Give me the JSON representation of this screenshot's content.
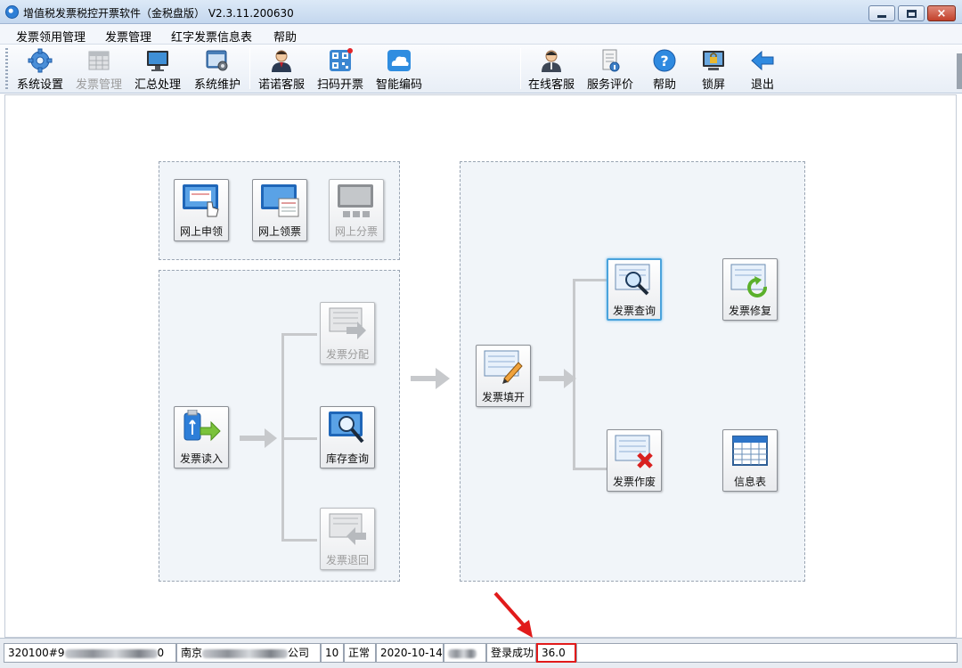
{
  "window": {
    "title": "增值税发票税控开票软件（金税盘版） V2.3.11.200630",
    "controls": {
      "minimize": "minimize",
      "maximize": "maximize",
      "close": "×"
    }
  },
  "menu": {
    "items": [
      "发票领用管理",
      "发票管理",
      "红字发票信息表",
      "帮助"
    ]
  },
  "toolbar": {
    "items": [
      {
        "label": "系统设置",
        "icon": "gear-icon",
        "enabled": true
      },
      {
        "label": "发票管理",
        "icon": "invoice-grid-icon",
        "enabled": false
      },
      {
        "label": "汇总处理",
        "icon": "monitor-icon",
        "enabled": true
      },
      {
        "label": "系统维护",
        "icon": "maintenance-window-icon",
        "enabled": true
      },
      {
        "label": "诺诺客服",
        "icon": "agent-icon",
        "enabled": true
      },
      {
        "label": "扫码开票",
        "icon": "qr-code-icon",
        "enabled": true
      },
      {
        "label": "智能编码",
        "icon": "cloud-icon",
        "enabled": true
      },
      {
        "label": "在线客服",
        "icon": "online-agent-icon",
        "enabled": true
      },
      {
        "label": "服务评价",
        "icon": "evaluation-icon",
        "enabled": true
      },
      {
        "label": "帮助",
        "icon": "help-icon",
        "enabled": true
      },
      {
        "label": "锁屏",
        "icon": "lock-screen-icon",
        "enabled": true
      },
      {
        "label": "退出",
        "icon": "exit-arrow-icon",
        "enabled": true
      }
    ]
  },
  "workflow": {
    "acquire": [
      {
        "label": "网上申领",
        "icon": "online-apply-icon",
        "enabled": true
      },
      {
        "label": "网上领票",
        "icon": "online-receive-icon",
        "enabled": true
      },
      {
        "label": "网上分票",
        "icon": "online-split-icon",
        "enabled": false
      }
    ],
    "distribute": {
      "read": {
        "label": "发票读入",
        "icon": "usb-import-icon",
        "enabled": true
      },
      "allocate": {
        "label": "发票分配",
        "icon": "invoice-allocate-icon",
        "enabled": false
      },
      "stock": {
        "label": "库存查询",
        "icon": "stock-query-icon",
        "enabled": true
      },
      "return": {
        "label": "发票退回",
        "icon": "invoice-return-icon",
        "enabled": false
      }
    },
    "issue": {
      "fill": {
        "label": "发票填开",
        "icon": "invoice-fill-icon",
        "enabled": true
      },
      "query": {
        "label": "发票查询",
        "icon": "invoice-query-icon",
        "enabled": true,
        "selected": true
      },
      "repair": {
        "label": "发票修复",
        "icon": "invoice-repair-icon",
        "enabled": true
      },
      "void": {
        "label": "发票作废",
        "icon": "invoice-void-icon",
        "enabled": true
      },
      "info": {
        "label": "信息表",
        "icon": "info-table-icon",
        "enabled": true
      }
    }
  },
  "statusbar": {
    "tax_id_prefix": "320100#9",
    "tax_id_suffix": "0",
    "company_prefix": "南京",
    "company_suffix": "公司",
    "count": "10",
    "state": "正常",
    "date": "2020-10-14",
    "message": "登录成功",
    "version": "36.0"
  },
  "colors": {
    "highlight_box": "#e11b1b",
    "selected_tile": "#4aa3dc",
    "panel_bg": "#f1f5f9"
  }
}
